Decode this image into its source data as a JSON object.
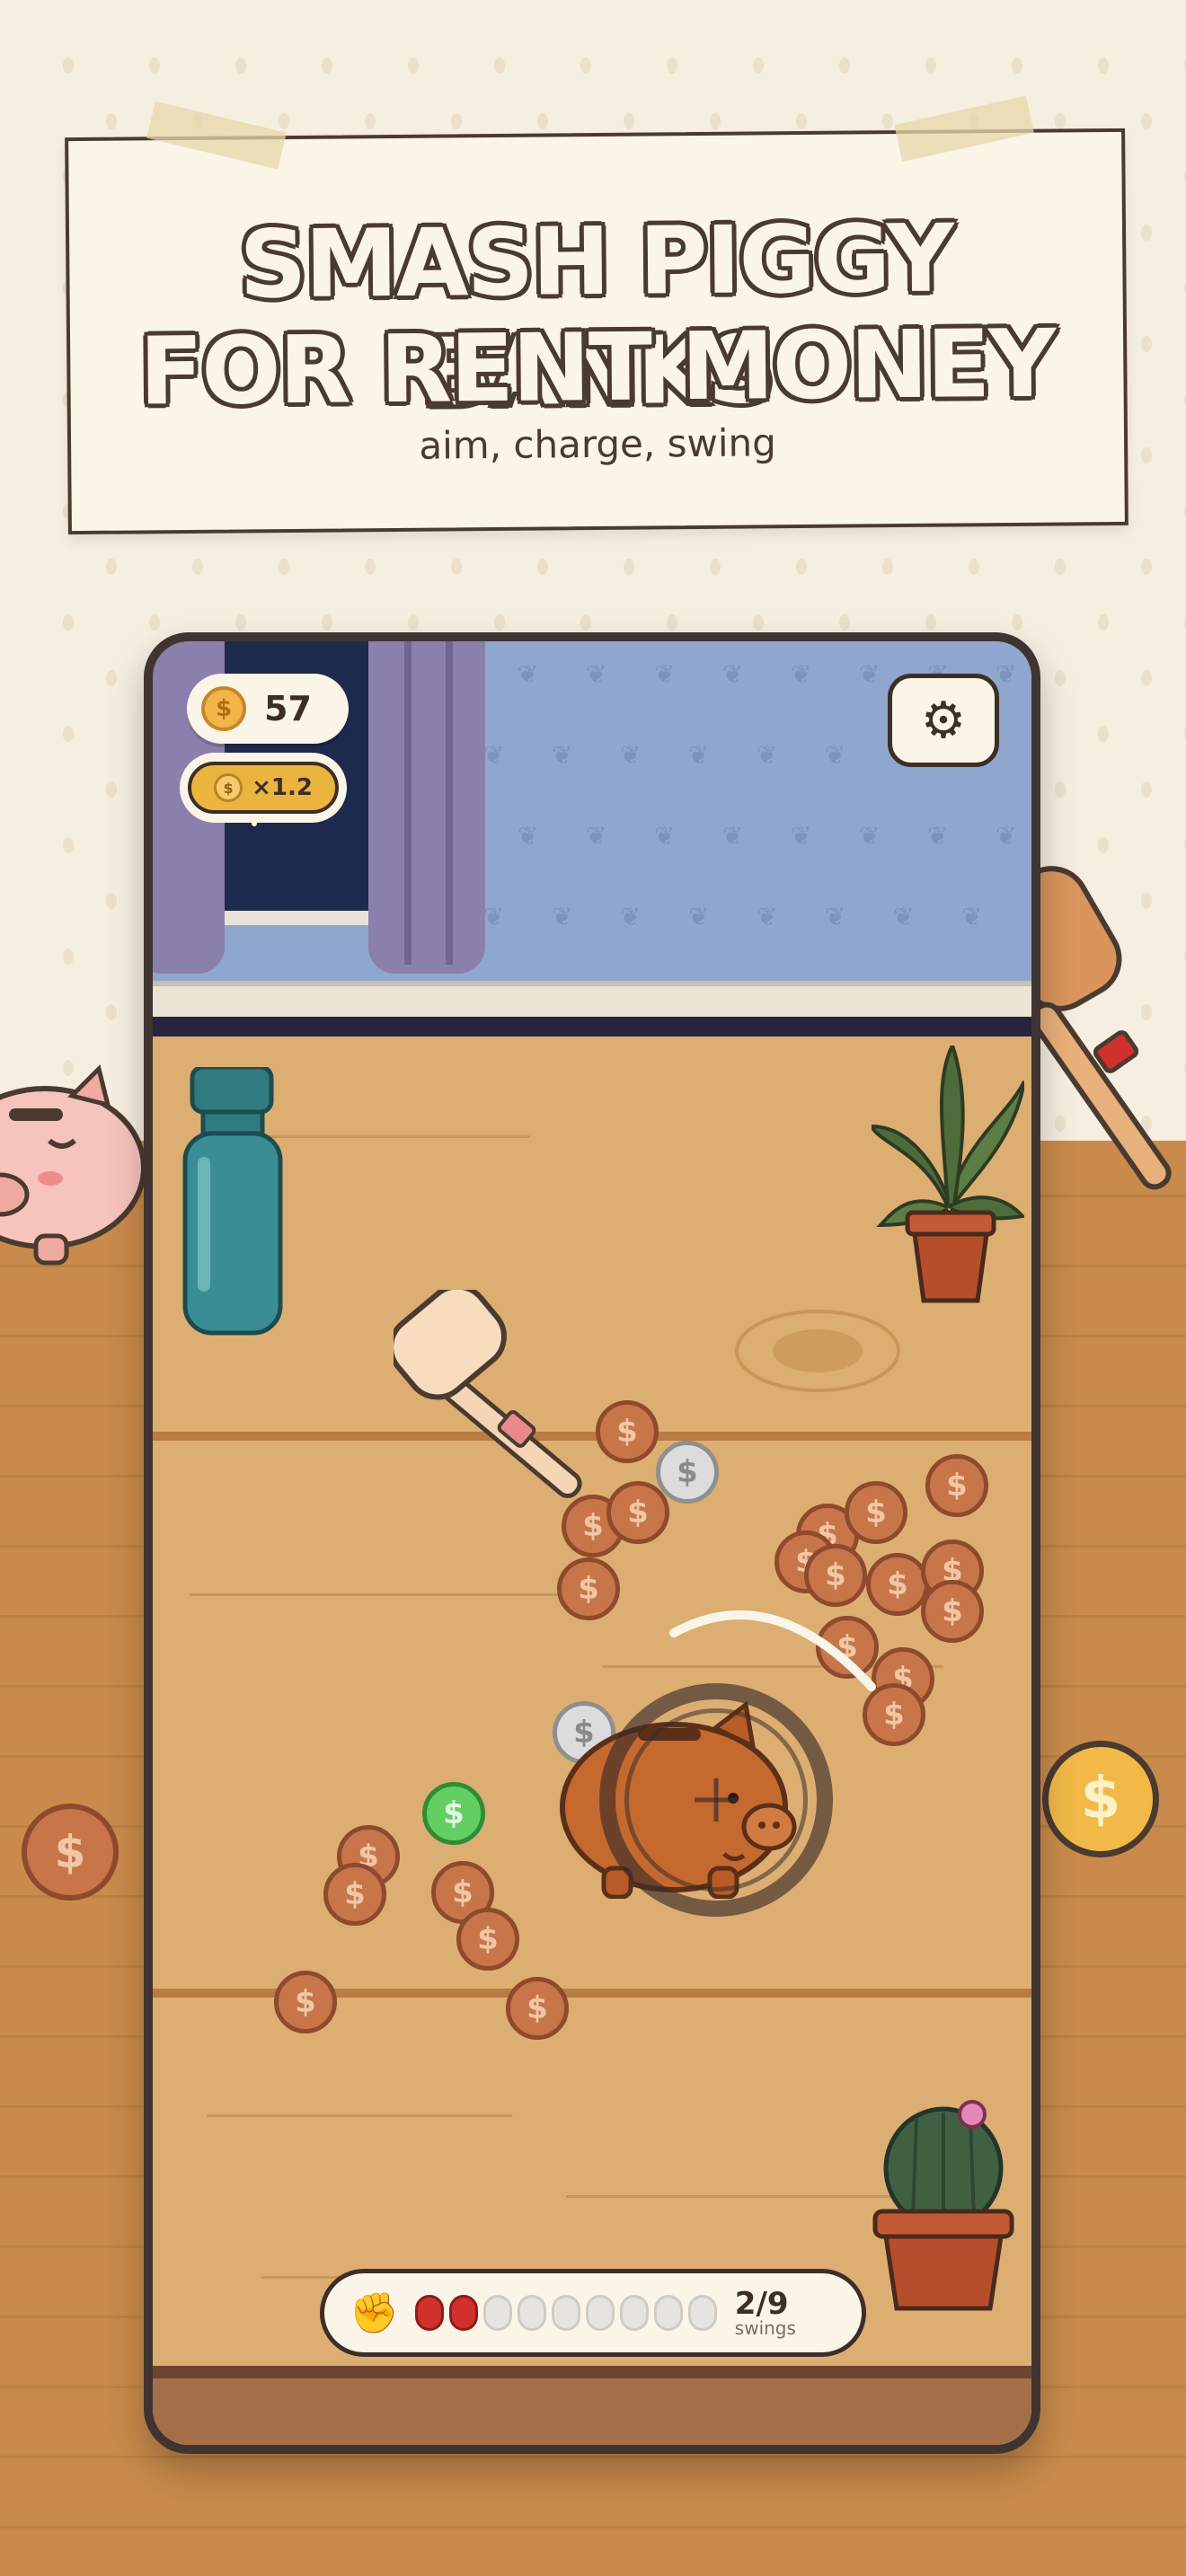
{
  "title_card": {
    "headline_line1": "SMASH PIGGY BANKS",
    "headline_line2": "FOR RENT MONEY",
    "subline": "aim, charge, swing"
  },
  "hud": {
    "coins": "57",
    "multiplier": "×1.2",
    "settings_icon": "gear-icon"
  },
  "swing_bar": {
    "icon": "fist-icon",
    "used": 2,
    "total": 9,
    "count_text": "2/9",
    "label": "swings"
  },
  "coin_symbol": "$",
  "colors": {
    "accent_gold": "#eab43e",
    "copper_coin": "#c8754a",
    "silver_coin": "#dcdcdc",
    "green_coin": "#63cf62",
    "swing_pip_active": "#d0312d",
    "outline": "#3d2e27"
  }
}
